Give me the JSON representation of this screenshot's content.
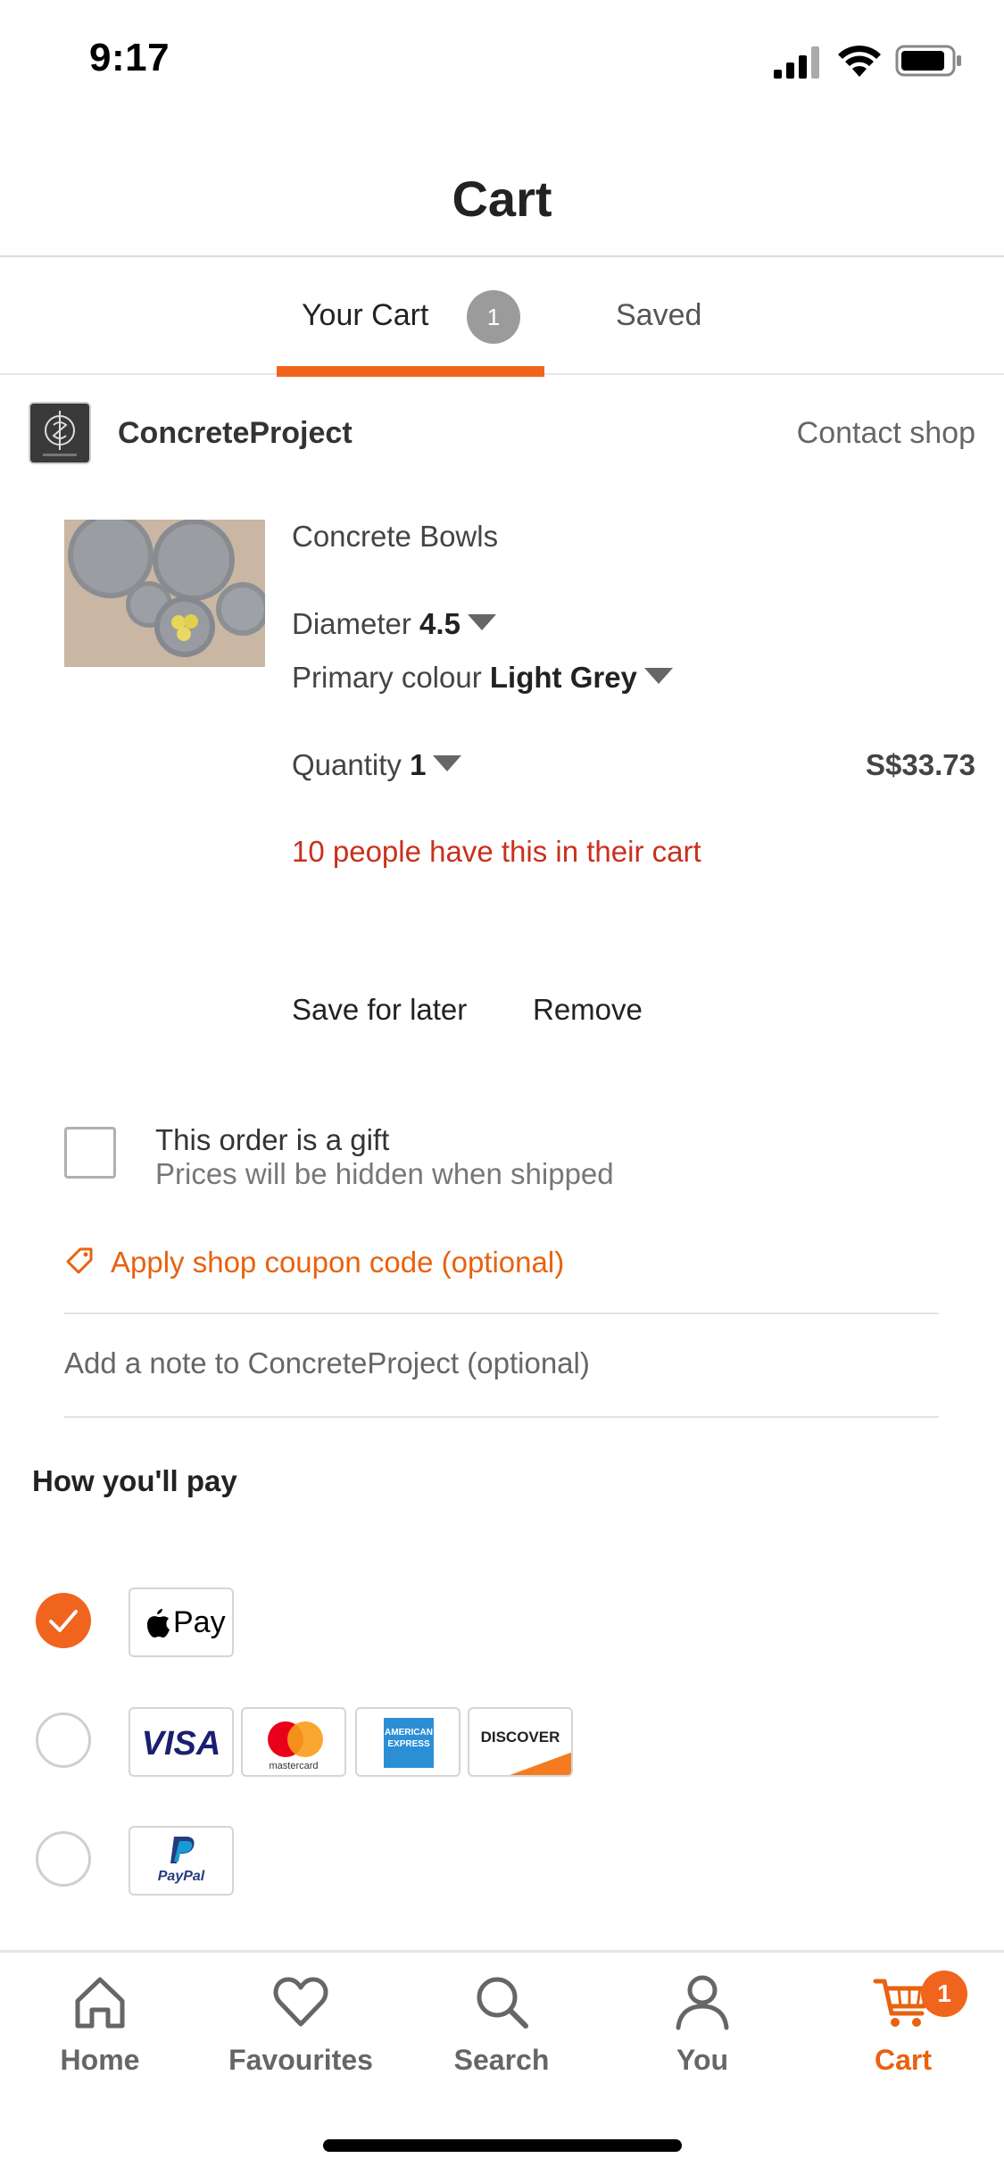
{
  "status_bar": {
    "time": "9:17"
  },
  "header": {
    "title": "Cart"
  },
  "tabs": {
    "cart_label": "Your Cart",
    "cart_count": "1",
    "saved_label": "Saved"
  },
  "shop": {
    "name": "ConcreteProject",
    "contact_label": "Contact shop"
  },
  "item": {
    "title": "Concrete Bowls",
    "diameter_label": "Diameter",
    "diameter_value": "4.5",
    "colour_label": "Primary colour",
    "colour_value": "Light Grey",
    "quantity_label": "Quantity",
    "quantity_value": "1",
    "price": "S$33.73",
    "cart_alert": "10 people have this in their cart",
    "save_for_later": "Save for later",
    "remove": "Remove"
  },
  "gift": {
    "title": "This order is a gift",
    "subtitle": "Prices will be hidden when shipped"
  },
  "coupon": {
    "label": "Apply shop coupon code (optional)"
  },
  "note": {
    "placeholder": "Add a note to ConcreteProject (optional)"
  },
  "payment": {
    "title": "How you'll pay",
    "apple_pay": "Pay",
    "visa": "VISA",
    "mastercard": "mastercard",
    "amex": "AMERICAN EXPRESS",
    "discover": "DISCOVER",
    "paypal": "PayPal"
  },
  "nav": {
    "home": "Home",
    "favourites": "Favourites",
    "search": "Search",
    "you": "You",
    "cart": "Cart",
    "cart_count": "1"
  },
  "colors": {
    "accent": "#f1641e",
    "alert": "#c9301c",
    "badge_grey": "#9b9b9b"
  }
}
